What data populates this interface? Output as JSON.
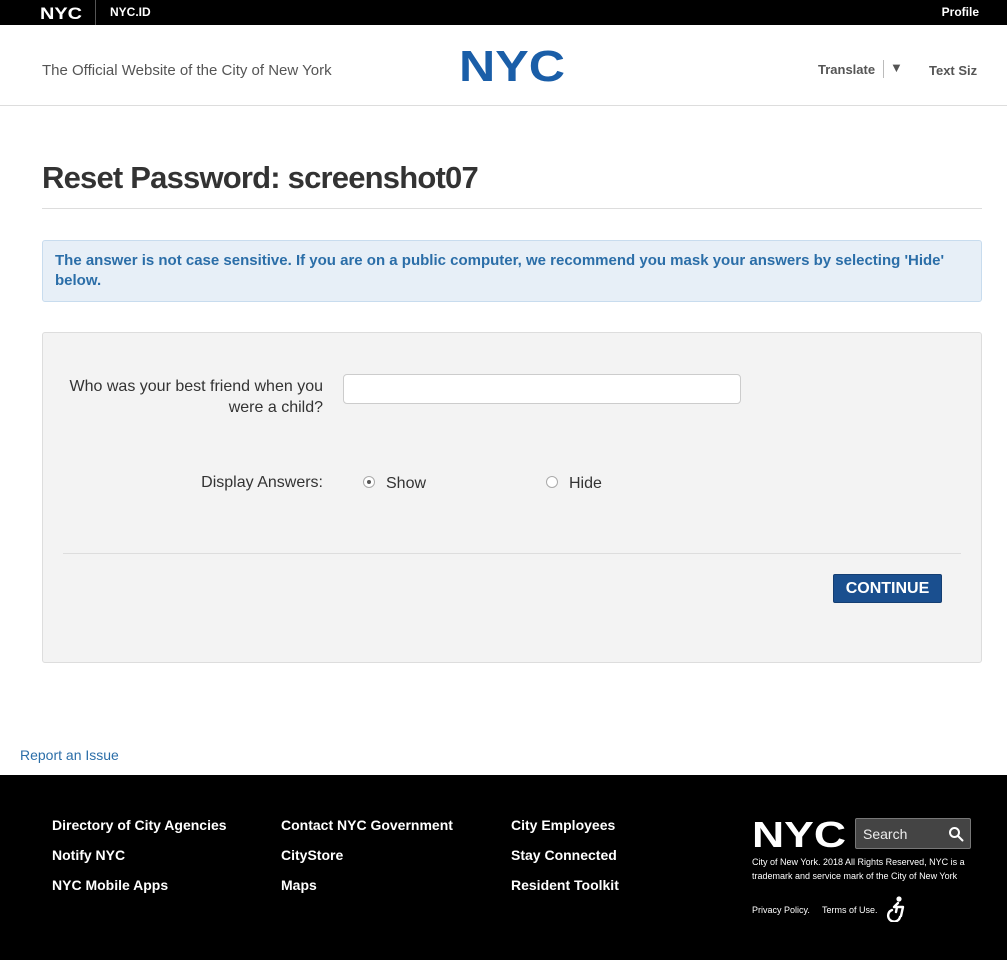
{
  "topbar": {
    "logo_text": "NYC",
    "nycid_label": "NYC.ID",
    "profile_label": "Profile"
  },
  "header": {
    "tagline": "The Official Website of the City of New York",
    "logo_text": "NYC",
    "translate_label": "Translate",
    "translate_arrow": "▼",
    "text_size_label": "Text Siz"
  },
  "page": {
    "title": "Reset Password: screenshot07",
    "notice": "The answer is not case sensitive. If you are on a public computer, we recommend you mask your answers by selecting 'Hide' below."
  },
  "form": {
    "question_label": "Who was your best friend when you were a child?",
    "answer_value": "",
    "display_label": "Display Answers:",
    "options": [
      {
        "label": "Show",
        "checked": true
      },
      {
        "label": "Hide",
        "checked": false
      }
    ],
    "continue_label": "CONTINUE"
  },
  "report_link": "Report an Issue",
  "footer": {
    "col1": [
      "Directory of City Agencies",
      "Notify NYC",
      "NYC Mobile Apps"
    ],
    "col2": [
      "Contact NYC Government",
      "CityStore",
      "Maps"
    ],
    "col3": [
      "City Employees",
      "Stay Connected",
      "Resident Toolkit"
    ],
    "logo_text": "NYC",
    "search_placeholder": "Search",
    "copyright": "City of New York. 2018 All Rights Reserved, NYC is a trademark and service mark of the City of New York",
    "privacy_label": "Privacy Policy.",
    "terms_label": "Terms of Use."
  },
  "colors": {
    "brand_blue": "#1a5ea8",
    "button_blue": "#1a4f8f",
    "notice_bg": "#e7eff7",
    "notice_text": "#2b6ea8"
  }
}
